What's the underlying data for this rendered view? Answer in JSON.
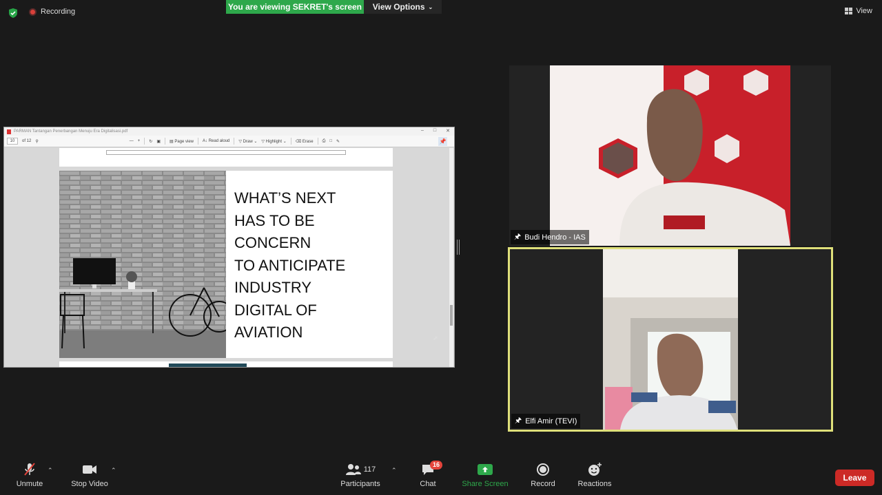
{
  "top": {
    "recording_label": "Recording",
    "viewing_banner": "You are viewing SEKRET's screen",
    "view_options_label": "View Options",
    "view_label": "View"
  },
  "pdf": {
    "window_title": "PARMAN Tantangan Penerbangan Menuju Era Digitalisasi.pdf",
    "page_current": "10",
    "page_total": "of 12",
    "tools": [
      "Page view",
      "Read aloud",
      "Draw",
      "Highlight",
      "Erase"
    ],
    "slide_lines": [
      "WHAT’S NEXT",
      "HAS TO BE",
      "CONCERN",
      "TO ANTICIPATE",
      "INDUSTRY",
      "DIGITAL OF",
      "AVIATION"
    ]
  },
  "participants": [
    {
      "name": "Budi Hendro - IAS"
    },
    {
      "name": "Elfi Amir (TEVI)"
    }
  ],
  "toolbar": {
    "unmute": "Unmute",
    "stop_video": "Stop Video",
    "participants_count": "117",
    "participants": "Participants",
    "chat_badge": "16",
    "chat": "Chat",
    "share_screen": "Share Screen",
    "record": "Record",
    "reactions": "Reactions",
    "leave": "Leave"
  },
  "colors": {
    "share_green": "#2ea84b",
    "leave_red": "#cc2a26",
    "active_speaker": "#dfe07a"
  }
}
